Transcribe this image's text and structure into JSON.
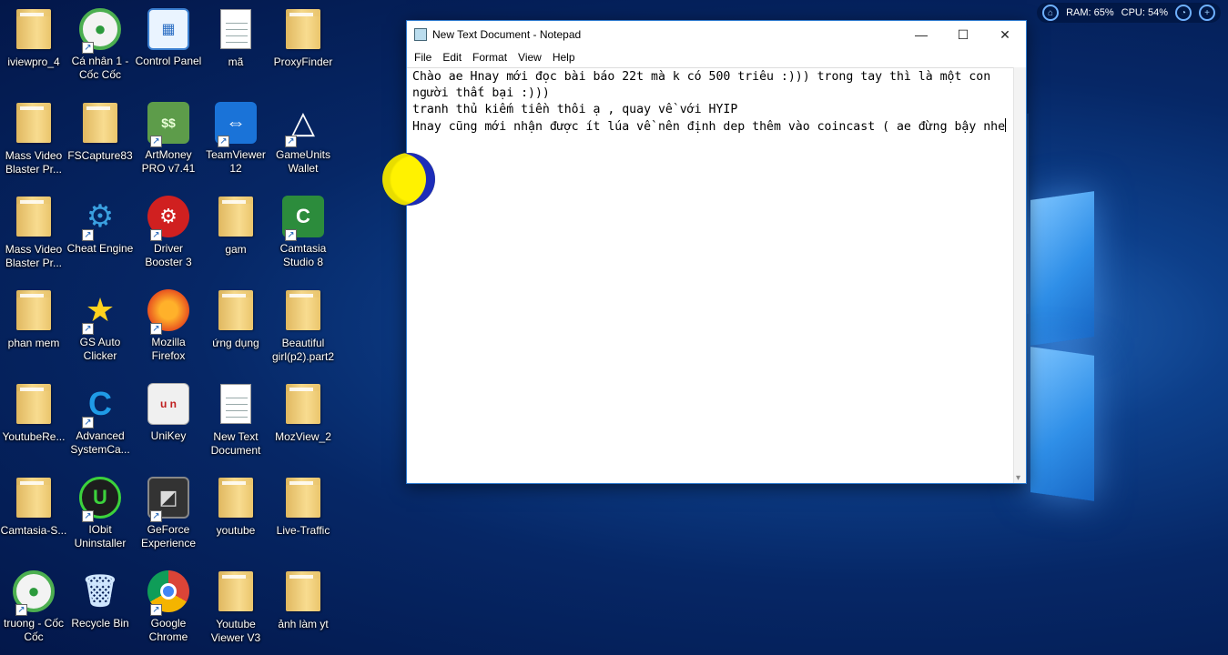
{
  "desktop": {
    "icons": [
      {
        "label": "iviewpro_4",
        "kind": "folder"
      },
      {
        "label": "Cá nhân 1 - Cốc Cốc",
        "kind": "coccoc"
      },
      {
        "label": "Control Panel",
        "kind": "controlpanel"
      },
      {
        "label": "mã",
        "kind": "doc"
      },
      {
        "label": "ProxyFinder",
        "kind": "folder"
      },
      {
        "label": "Mass Video Blaster Pr...",
        "kind": "folder"
      },
      {
        "label": "FSCapture83",
        "kind": "folder"
      },
      {
        "label": "ArtMoney PRO v7.41",
        "kind": "artmoney"
      },
      {
        "label": "TeamViewer 12",
        "kind": "teamviewer"
      },
      {
        "label": "GameUnits Wallet",
        "kind": "gameunits"
      },
      {
        "label": "Mass Video Blaster Pr...",
        "kind": "folder"
      },
      {
        "label": "Cheat Engine",
        "kind": "cheatengine"
      },
      {
        "label": "Driver Booster 3",
        "kind": "driverbooster"
      },
      {
        "label": "gam",
        "kind": "folder"
      },
      {
        "label": "Camtasia Studio 8",
        "kind": "camtasia"
      },
      {
        "label": "phan mem",
        "kind": "folder"
      },
      {
        "label": "GS Auto Clicker",
        "kind": "gsclicker"
      },
      {
        "label": "Mozilla Firefox",
        "kind": "firefox"
      },
      {
        "label": "ứng dụng",
        "kind": "folder"
      },
      {
        "label": "Beautiful girl(p2).part2",
        "kind": "folder"
      },
      {
        "label": "YoutubeRe...",
        "kind": "folder"
      },
      {
        "label": "Advanced SystemCa...",
        "kind": "advancedsc"
      },
      {
        "label": "UniKey",
        "kind": "unikey"
      },
      {
        "label": "New Text Document",
        "kind": "doc"
      },
      {
        "label": "MozView_2",
        "kind": "folder"
      },
      {
        "label": "Camtasia-S...",
        "kind": "folder"
      },
      {
        "label": "IObit Uninstaller",
        "kind": "iobit"
      },
      {
        "label": "GeForce Experience",
        "kind": "geforce"
      },
      {
        "label": "youtube",
        "kind": "folder"
      },
      {
        "label": "Live-Traffic",
        "kind": "folder"
      },
      {
        "label": "truong - Cốc Cốc",
        "kind": "coccoc"
      },
      {
        "label": "Recycle Bin",
        "kind": "recyclebin"
      },
      {
        "label": "Google Chrome",
        "kind": "chrome"
      },
      {
        "label": "Youtube Viewer V3",
        "kind": "folder"
      },
      {
        "label": "ảnh làm yt",
        "kind": "folder"
      }
    ]
  },
  "sysmon": {
    "ram": "RAM: 65%",
    "cpu": "CPU: 54%"
  },
  "notepad": {
    "title": "New Text Document - Notepad",
    "menu": [
      "File",
      "Edit",
      "Format",
      "View",
      "Help"
    ],
    "lines": [
      "Chào ae Hnay mới đọc bài báo 22t mà k có 500 triêu :))) trong tay thì là một con",
      "người thất bại :)))",
      "tranh thủ kiếm tiền thôi ạ , quay về với HYIP",
      "Hnay cũng mới nhận được ít lúa về nên định dep thêm vào coincast ( ae đừng bậy nhe"
    ]
  }
}
